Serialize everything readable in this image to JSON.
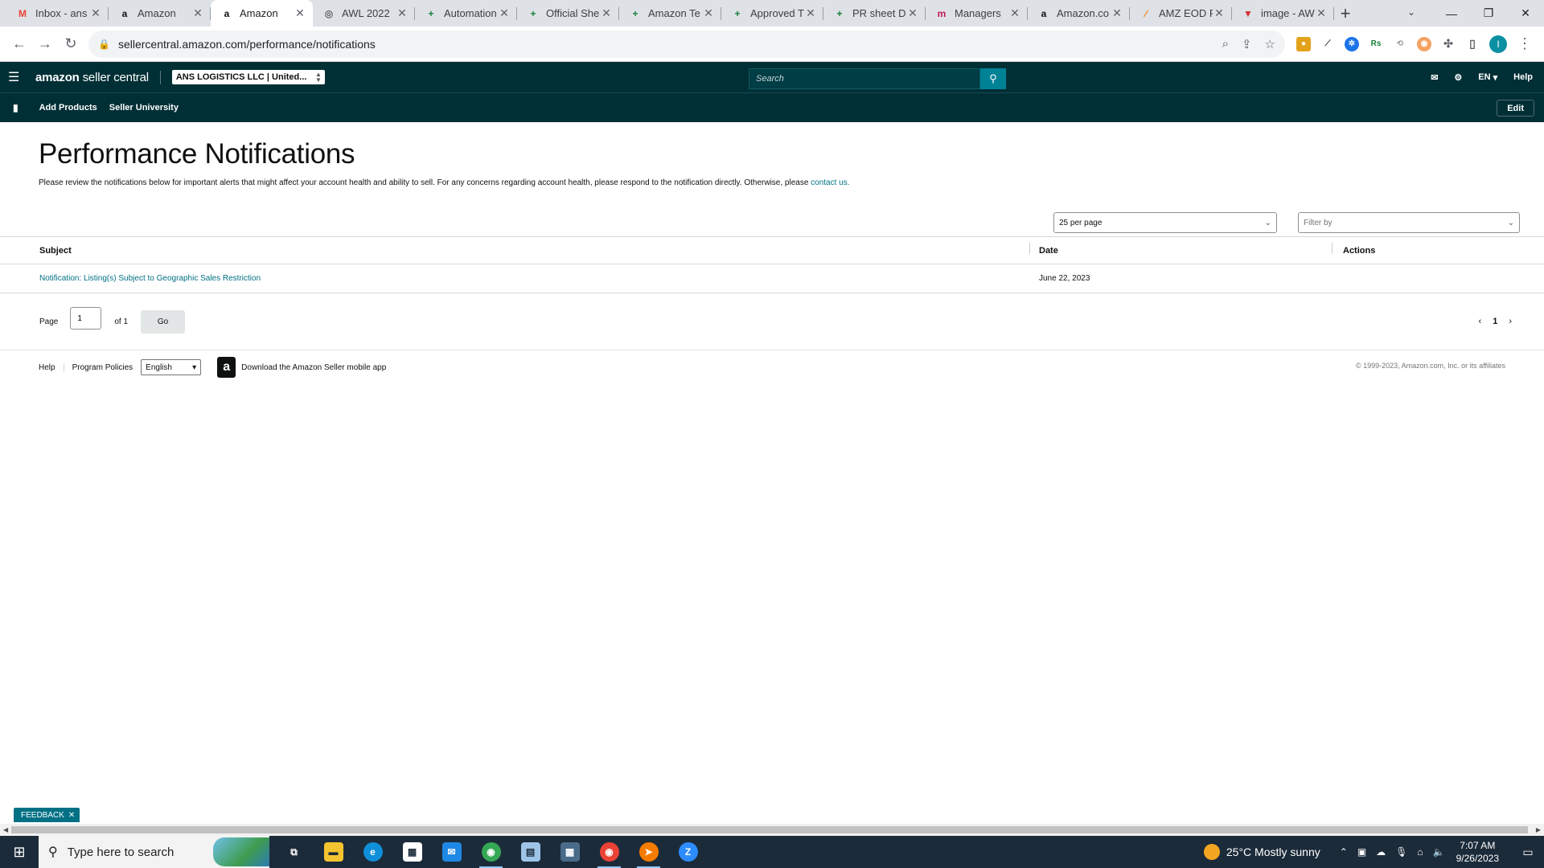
{
  "browser": {
    "tabs": [
      {
        "title": "Inbox - ans",
        "fav_text": "M",
        "fav_color": "#ea4335",
        "active": false
      },
      {
        "title": "Amazon",
        "fav_text": "a",
        "fav_color": "#0f1111",
        "active": false
      },
      {
        "title": "Amazon",
        "fav_text": "a",
        "fav_color": "#0f1111",
        "active": true
      },
      {
        "title": "AWL 2022",
        "fav_text": "◎",
        "fav_color": "#5f6368",
        "active": false
      },
      {
        "title": "Automation",
        "fav_text": "+",
        "fav_color": "#188038",
        "active": false
      },
      {
        "title": "Official She",
        "fav_text": "+",
        "fav_color": "#188038",
        "active": false
      },
      {
        "title": "Amazon Te",
        "fav_text": "+",
        "fav_color": "#188038",
        "active": false
      },
      {
        "title": "Approved T",
        "fav_text": "+",
        "fav_color": "#188038",
        "active": false
      },
      {
        "title": "PR sheet D",
        "fav_text": "+",
        "fav_color": "#188038",
        "active": false
      },
      {
        "title": "Managers",
        "fav_text": "m",
        "fav_color": "#c2185b",
        "active": false
      },
      {
        "title": "Amazon.co",
        "fav_text": "a",
        "fav_color": "#0f1111",
        "active": false
      },
      {
        "title": "AMZ EOD R",
        "fav_text": "∕",
        "fav_color": "#f57c00",
        "active": false
      },
      {
        "title": "image - AW",
        "fav_text": "▼",
        "fav_color": "#d32f2f",
        "active": false
      }
    ],
    "url": "sellercentral.amazon.com/performance/notifications",
    "profile_initial": "I"
  },
  "header": {
    "logo_bold": "amazon",
    "logo_light": " seller central",
    "account": "ANS LOGISTICS LLC | United...",
    "search_placeholder": "Search",
    "lang": "EN",
    "help": "Help"
  },
  "subnav": {
    "links": [
      "Add Products",
      "Seller University"
    ],
    "edit": "Edit"
  },
  "page": {
    "title": "Performance Notifications",
    "description": "Please review the notifications below for important alerts that might affect your account health and ability to sell. For any concerns regarding account health, please respond to the notification directly. Otherwise, please ",
    "contact_link": "contact us.",
    "per_page": "25 per page",
    "filter_placeholder": "Filter by"
  },
  "table": {
    "headers": [
      "Subject",
      "Date",
      "Actions"
    ],
    "rows": [
      {
        "subject": "Notification: Listing(s) Subject to Geographic Sales Restriction",
        "date": "June 22, 2023",
        "actions": ""
      }
    ]
  },
  "pager": {
    "label": "Page",
    "value": "1",
    "of": "of 1",
    "go": "Go",
    "current": "1"
  },
  "footer": {
    "help": "Help",
    "policies": "Program Policies",
    "language": "English",
    "app": "Download the Amazon Seller mobile app",
    "copyright": "© 1999-2023, Amazon.com, Inc. or its affiliates"
  },
  "feedback": "FEEDBACK",
  "taskbar": {
    "search_placeholder": "Type here to search",
    "weather": "25°C  Mostly sunny",
    "time": "7:07 AM",
    "date": "9/26/2023"
  },
  "colors": {
    "header_bg": "#002f36",
    "link": "#007185",
    "search_btn": "#008296"
  }
}
